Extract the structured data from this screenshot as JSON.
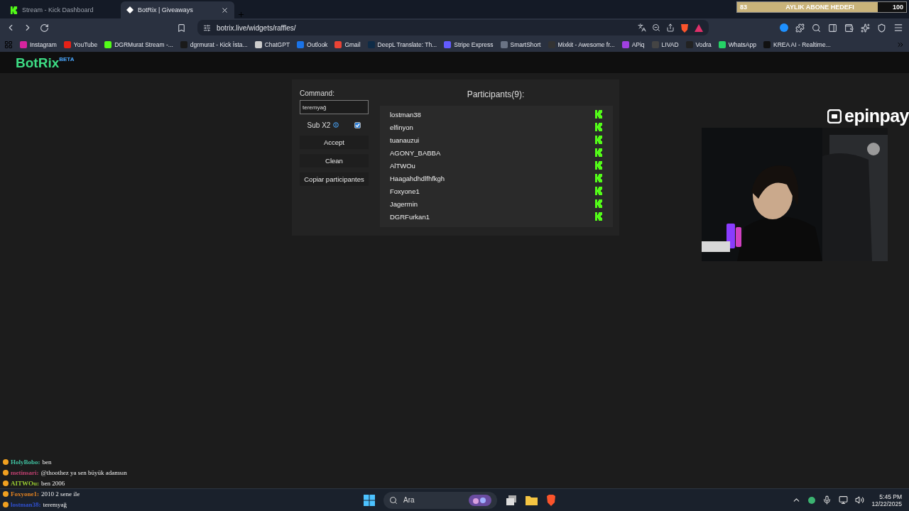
{
  "browser": {
    "tabs": [
      {
        "title": "Stream - Kick Dashboard",
        "kind": "kick",
        "selected": false
      },
      {
        "title": "BotRix | Giveaways",
        "kind": "diamond",
        "selected": true
      }
    ],
    "goal": {
      "current": "83",
      "label": "AYLIK ABONE HEDEFI",
      "target": "100",
      "level": 0.83
    },
    "address": "botrix.live/widgets/raffles/",
    "bookmarks": [
      {
        "label": "Instagram",
        "color": "#d6249f"
      },
      {
        "label": "YouTube",
        "color": "#e62117"
      },
      {
        "label": "DGRMurat Stream -...",
        "color": "#53fc18"
      },
      {
        "label": "dgrmurat - Kick İsta...",
        "color": "#1a1a1a"
      },
      {
        "label": "ChatGPT",
        "color": "#cccccc"
      },
      {
        "label": "Outlook",
        "color": "#1a73e8"
      },
      {
        "label": "Gmail",
        "color": "#ea4335"
      },
      {
        "label": "DeepL Translate: Th...",
        "color": "#0f2b46"
      },
      {
        "label": "Stripe Express",
        "color": "#635bff"
      },
      {
        "label": "SmartShort",
        "color": "#6a7384"
      },
      {
        "label": "Mixkit - Awesome fr...",
        "color": "#333333"
      },
      {
        "label": "APiq",
        "color": "#a040e0"
      },
      {
        "label": "LIVAD",
        "color": "#444444"
      },
      {
        "label": "Vodra",
        "color": "#222222"
      },
      {
        "label": "WhatsApp",
        "color": "#25d366"
      },
      {
        "label": "KREA AI - Realtime...",
        "color": "#111111"
      }
    ]
  },
  "app": {
    "logo": "BotRix",
    "badge": "BETA",
    "command_label": "Command:",
    "command_value": "teremyağ",
    "sub_label": "Sub X2",
    "sub_checked": true,
    "buttons": [
      "Accept",
      "Clean",
      "Copiar participantes"
    ],
    "participants_title": "Participants(9):",
    "participants": [
      "lostman38",
      "elfinyon",
      "tuanauzui",
      "AGONY_BABBA",
      "AlTWOu",
      "Haagahdhdlfhfkgh",
      "Foxyone1",
      "Jagermin",
      "DGRFurkan1"
    ]
  },
  "overlay": {
    "sponsor": "epinpay"
  },
  "chat": [
    {
      "user": "HolyBobo:",
      "text": "ben",
      "color": "#3fbf9f"
    },
    {
      "user": "metinsari:",
      "text": "@thoothez ya sen büyük adamsın",
      "color": "#c04070"
    },
    {
      "user": "AITWOu:",
      "text": "ben 2006",
      "color": "#9acd32"
    },
    {
      "user": "Foxyone1:",
      "text": "2010 2 sene ile",
      "color": "#e08020"
    },
    {
      "user": "lostman38:",
      "text": "teremyağ",
      "color": "#3050d0"
    }
  ],
  "taskbar": {
    "search": "Ara",
    "time": "5:45 PM",
    "date": "12/22/2025"
  }
}
